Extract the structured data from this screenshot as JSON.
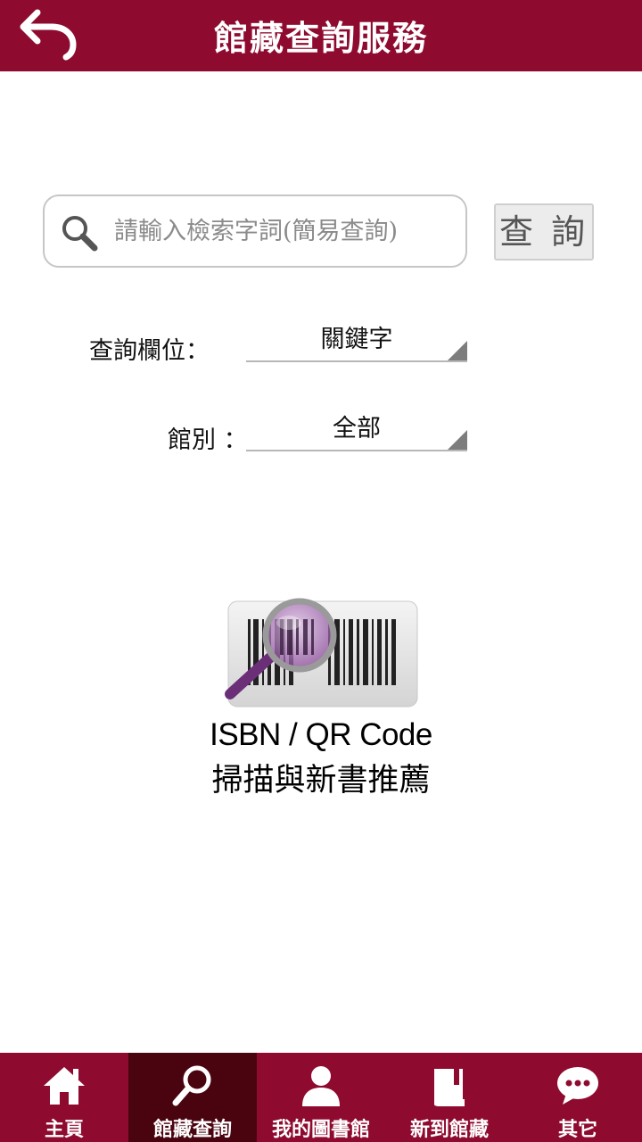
{
  "header": {
    "title": "館藏查詢服務",
    "back_icon": "back-arrow-icon"
  },
  "search": {
    "placeholder": "請輸入檢索字詞(簡易查詢)",
    "value": "",
    "button_label": "查 詢",
    "icon": "search-icon"
  },
  "filters": {
    "field_label": "查詢欄位：",
    "field_value": "關鍵字",
    "library_label": "館別 ：",
    "library_value": "全部"
  },
  "scan": {
    "line1": "ISBN / QR Code",
    "line2": "掃描與新書推薦",
    "icon": "barcode-scan-icon"
  },
  "tabbar": {
    "items": [
      {
        "label": "主頁",
        "icon": "home-icon",
        "active": false
      },
      {
        "label": "館藏查詢",
        "icon": "search-icon",
        "active": true
      },
      {
        "label": "我的圖書館",
        "icon": "user-icon",
        "active": false
      },
      {
        "label": "新到館藏",
        "icon": "book-icon",
        "active": false
      },
      {
        "label": "其它",
        "icon": "chat-bubble-icon",
        "active": false
      }
    ]
  },
  "colors": {
    "brand": "#8e0b2f",
    "active_tab": "#4a0410"
  }
}
